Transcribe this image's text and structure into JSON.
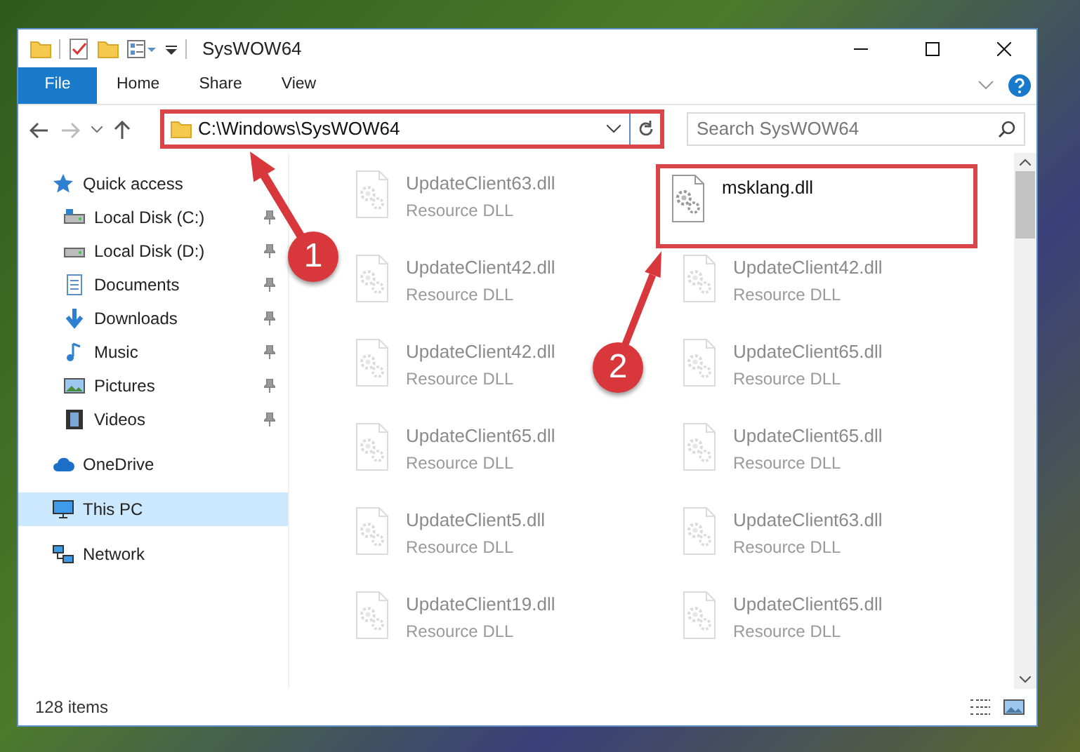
{
  "window": {
    "title": "SysWOW64"
  },
  "ribbon_tabs": [
    {
      "label": "File",
      "selected": true
    },
    {
      "label": "Home",
      "selected": false
    },
    {
      "label": "Share",
      "selected": false
    },
    {
      "label": "View",
      "selected": false
    }
  ],
  "address": {
    "path": "C:\\Windows\\SysWOW64",
    "highlighted": true
  },
  "search": {
    "placeholder": "Search SysWOW64"
  },
  "nav": [
    {
      "label": "Quick access",
      "selected": false,
      "children": [
        {
          "label": "Local Disk (C:)",
          "pinned": true,
          "selected": false
        },
        {
          "label": "Local Disk (D:)",
          "pinned": true,
          "selected": false
        },
        {
          "label": "Documents",
          "pinned": true,
          "selected": false
        },
        {
          "label": "Downloads",
          "pinned": true,
          "selected": false
        },
        {
          "label": "Music",
          "pinned": true,
          "selected": false
        },
        {
          "label": "Pictures",
          "pinned": true,
          "selected": false
        },
        {
          "label": "Videos",
          "pinned": true,
          "selected": false
        }
      ]
    },
    {
      "label": "OneDrive",
      "selected": false
    },
    {
      "label": "This PC",
      "selected": true
    },
    {
      "label": "Network",
      "selected": false
    }
  ],
  "files": [
    {
      "name": "UpdateClient63.dll",
      "type": "Resource DLL",
      "faded": true,
      "highlighted": false
    },
    {
      "name": "msklang.dll",
      "faded": false,
      "highlighted": true
    },
    {
      "name": "UpdateClient42.dll",
      "type": "Resource DLL",
      "faded": true,
      "highlighted": false
    },
    {
      "name": "UpdateClient42.dll",
      "type": "Resource DLL",
      "faded": true,
      "highlighted": false
    },
    {
      "name": "UpdateClient42.dll",
      "type": "Resource DLL",
      "faded": true,
      "highlighted": false
    },
    {
      "name": "UpdateClient65.dll",
      "type": "Resource DLL",
      "faded": true,
      "highlighted": false
    },
    {
      "name": "UpdateClient65.dll",
      "type": "Resource DLL",
      "faded": true,
      "highlighted": false
    },
    {
      "name": "UpdateClient65.dll",
      "type": "Resource DLL",
      "faded": true,
      "highlighted": false
    },
    {
      "name": "UpdateClient5.dll",
      "type": "Resource DLL",
      "faded": true,
      "highlighted": false
    },
    {
      "name": "UpdateClient63.dll",
      "type": "Resource DLL",
      "faded": true,
      "highlighted": false
    },
    {
      "name": "UpdateClient19.dll",
      "type": "Resource DLL",
      "faded": true,
      "highlighted": false
    },
    {
      "name": "UpdateClient65.dll",
      "type": "Resource DLL",
      "faded": true,
      "highlighted": false
    }
  ],
  "status_bar": {
    "items": "128 items"
  },
  "annotations": [
    {
      "number": "1"
    },
    {
      "number": "2"
    }
  ]
}
